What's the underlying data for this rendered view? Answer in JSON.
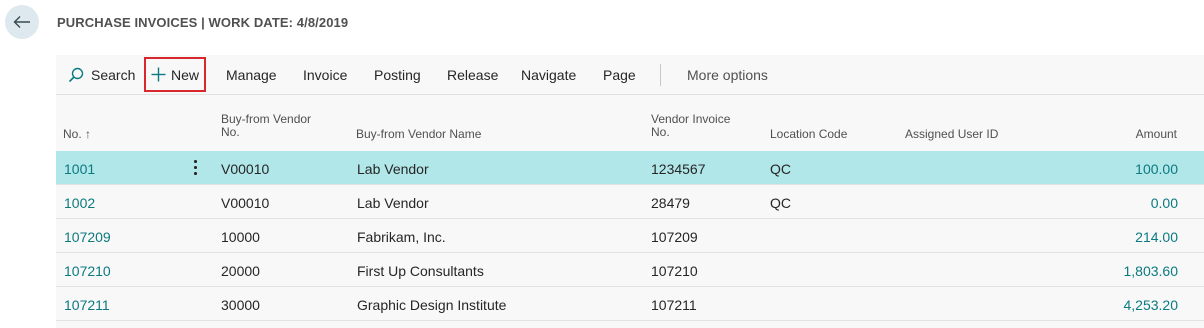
{
  "header": {
    "title": "PURCHASE INVOICES | WORK DATE: 4/8/2019",
    "back_icon": "arrow-left-icon"
  },
  "actions": {
    "search": "Search",
    "new": "New",
    "manage": "Manage",
    "invoice": "Invoice",
    "posting": "Posting",
    "release": "Release",
    "navigate": "Navigate",
    "page": "Page",
    "more_options": "More options"
  },
  "table": {
    "columns": {
      "no": "No. ↑",
      "vendor_no_line1": "Buy-from Vendor",
      "vendor_no_line2": "No.",
      "vendor_name": "Buy-from Vendor Name",
      "vendor_invoice_line1": "Vendor Invoice",
      "vendor_invoice_line2": "No.",
      "location": "Location Code",
      "assigned_user": "Assigned User ID",
      "amount": "Amount"
    },
    "rows": [
      {
        "no": "1001",
        "vendor_no": "V00010",
        "vendor_name": "Lab Vendor",
        "vendor_invoice": "1234567",
        "location": "QC",
        "assigned_user": "",
        "amount": "100.00"
      },
      {
        "no": "1002",
        "vendor_no": "V00010",
        "vendor_name": "Lab Vendor",
        "vendor_invoice": "28479",
        "location": "QC",
        "assigned_user": "",
        "amount": "0.00"
      },
      {
        "no": "107209",
        "vendor_no": "10000",
        "vendor_name": "Fabrikam, Inc.",
        "vendor_invoice": "107209",
        "location": "",
        "assigned_user": "",
        "amount": "214.00"
      },
      {
        "no": "107210",
        "vendor_no": "20000",
        "vendor_name": "First Up Consultants",
        "vendor_invoice": "107210",
        "location": "",
        "assigned_user": "",
        "amount": "1,803.60"
      },
      {
        "no": "107211",
        "vendor_no": "30000",
        "vendor_name": "Graphic Design Institute",
        "vendor_invoice": "107211",
        "location": "",
        "assigned_user": "",
        "amount": "4,253.20"
      }
    ]
  },
  "colors": {
    "accent": "#0b7a81",
    "selected_row": "#b1e7e9",
    "highlight_box": "#d9272e"
  }
}
